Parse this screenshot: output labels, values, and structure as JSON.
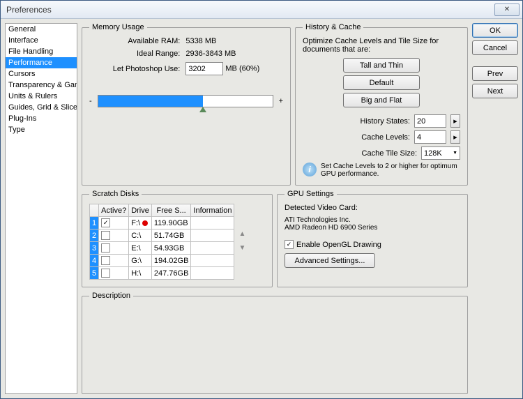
{
  "window": {
    "title": "Preferences"
  },
  "sidebar": {
    "items": [
      {
        "label": "General"
      },
      {
        "label": "Interface"
      },
      {
        "label": "File Handling"
      },
      {
        "label": "Performance",
        "selected": true
      },
      {
        "label": "Cursors"
      },
      {
        "label": "Transparency & Gamut"
      },
      {
        "label": "Units & Rulers"
      },
      {
        "label": "Guides, Grid & Slices"
      },
      {
        "label": "Plug-Ins"
      },
      {
        "label": "Type"
      }
    ]
  },
  "buttons": {
    "ok": "OK",
    "cancel": "Cancel",
    "prev": "Prev",
    "next": "Next"
  },
  "memory": {
    "legend": "Memory Usage",
    "available_label": "Available RAM:",
    "available_value": "5338 MB",
    "ideal_label": "Ideal Range:",
    "ideal_value": "2936-3843 MB",
    "use_label": "Let Photoshop Use:",
    "use_value": "3202",
    "use_suffix": "MB (60%)",
    "minus": "-",
    "plus": "+"
  },
  "history": {
    "legend": "History & Cache",
    "desc": "Optimize Cache Levels and Tile Size for documents that are:",
    "tall": "Tall and Thin",
    "default": "Default",
    "big": "Big and Flat",
    "states_label": "History States:",
    "states_value": "20",
    "levels_label": "Cache Levels:",
    "levels_value": "4",
    "tile_label": "Cache Tile Size:",
    "tile_value": "128K",
    "info": "Set Cache Levels to 2 or higher for optimum GPU performance."
  },
  "scratch": {
    "legend": "Scratch Disks",
    "headers": {
      "active": "Active?",
      "drive": "Drive",
      "free": "Free S...",
      "info": "Information"
    },
    "rows": [
      {
        "n": "1",
        "active": true,
        "drive": "F:\\",
        "dot": true,
        "free": "119.90GB",
        "info": ""
      },
      {
        "n": "2",
        "active": false,
        "drive": "C:\\",
        "dot": false,
        "free": "51.74GB",
        "info": ""
      },
      {
        "n": "3",
        "active": false,
        "drive": "E:\\",
        "dot": false,
        "free": "54.93GB",
        "info": ""
      },
      {
        "n": "4",
        "active": false,
        "drive": "G:\\",
        "dot": false,
        "free": "194.02GB",
        "info": ""
      },
      {
        "n": "5",
        "active": false,
        "drive": "H:\\",
        "dot": false,
        "free": "247.76GB",
        "info": ""
      }
    ]
  },
  "gpu": {
    "legend": "GPU Settings",
    "detected_label": "Detected Video Card:",
    "vendor": "ATI Technologies Inc.",
    "card": "AMD Radeon HD 6900 Series",
    "enable_label": "Enable OpenGL Drawing",
    "advanced": "Advanced Settings..."
  },
  "description": {
    "legend": "Description"
  }
}
